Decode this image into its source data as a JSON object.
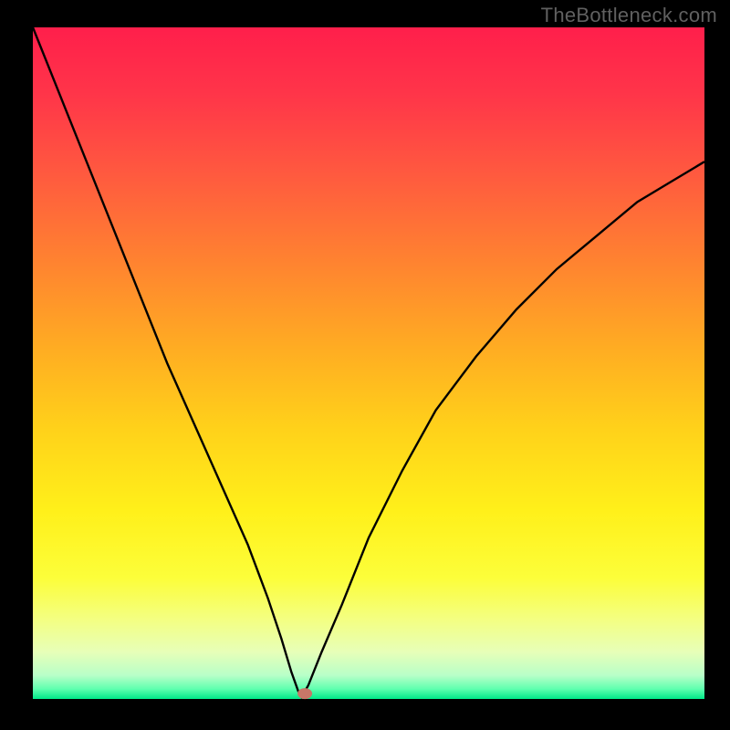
{
  "watermark": "TheBottleneck.com",
  "plot": {
    "inner_left": 36,
    "inner_top": 30,
    "inner_width": 736,
    "inner_height": 736,
    "marker": {
      "x_frac": 0.405,
      "y_frac": 0.992,
      "rx": 8,
      "ry": 6,
      "fill": "#c77768"
    }
  },
  "colors": {
    "curve": "#000000",
    "gradient_stops": [
      {
        "offset": 0.0,
        "color": "#ff1f4b"
      },
      {
        "offset": 0.1,
        "color": "#ff3549"
      },
      {
        "offset": 0.22,
        "color": "#ff5a3f"
      },
      {
        "offset": 0.35,
        "color": "#ff8330"
      },
      {
        "offset": 0.48,
        "color": "#ffad22"
      },
      {
        "offset": 0.6,
        "color": "#ffd21a"
      },
      {
        "offset": 0.72,
        "color": "#fff01a"
      },
      {
        "offset": 0.82,
        "color": "#fcfe3a"
      },
      {
        "offset": 0.88,
        "color": "#f4ff80"
      },
      {
        "offset": 0.93,
        "color": "#e7ffb8"
      },
      {
        "offset": 0.965,
        "color": "#b8ffc8"
      },
      {
        "offset": 0.985,
        "color": "#5fffaf"
      },
      {
        "offset": 1.0,
        "color": "#00e888"
      }
    ]
  },
  "chart_data": {
    "type": "line",
    "title": "",
    "xlabel": "",
    "ylabel": "",
    "xlim": [
      0,
      100
    ],
    "ylim": [
      0,
      100
    ],
    "note": "V-shaped bottleneck curve; minimum (≈0) near x≈40. Left branch starts ≈100 at x=0 and drops to 0; right branch rises from 0 to ≈80 at x=100.",
    "series": [
      {
        "name": "left-branch",
        "x": [
          0,
          4,
          8,
          12,
          16,
          20,
          24,
          28,
          32,
          35,
          37,
          38.5,
          39.5,
          40
        ],
        "values": [
          100,
          90,
          80,
          70,
          60,
          50,
          41,
          32,
          23,
          15,
          9,
          4,
          1.2,
          0.3
        ]
      },
      {
        "name": "right-branch",
        "x": [
          40,
          41,
          43,
          46,
          50,
          55,
          60,
          66,
          72,
          78,
          84,
          90,
          95,
          100
        ],
        "values": [
          0.3,
          2,
          7,
          14,
          24,
          34,
          43,
          51,
          58,
          64,
          69,
          74,
          77,
          80
        ]
      }
    ],
    "marker_point": {
      "x": 40.5,
      "y": 0.3
    }
  }
}
